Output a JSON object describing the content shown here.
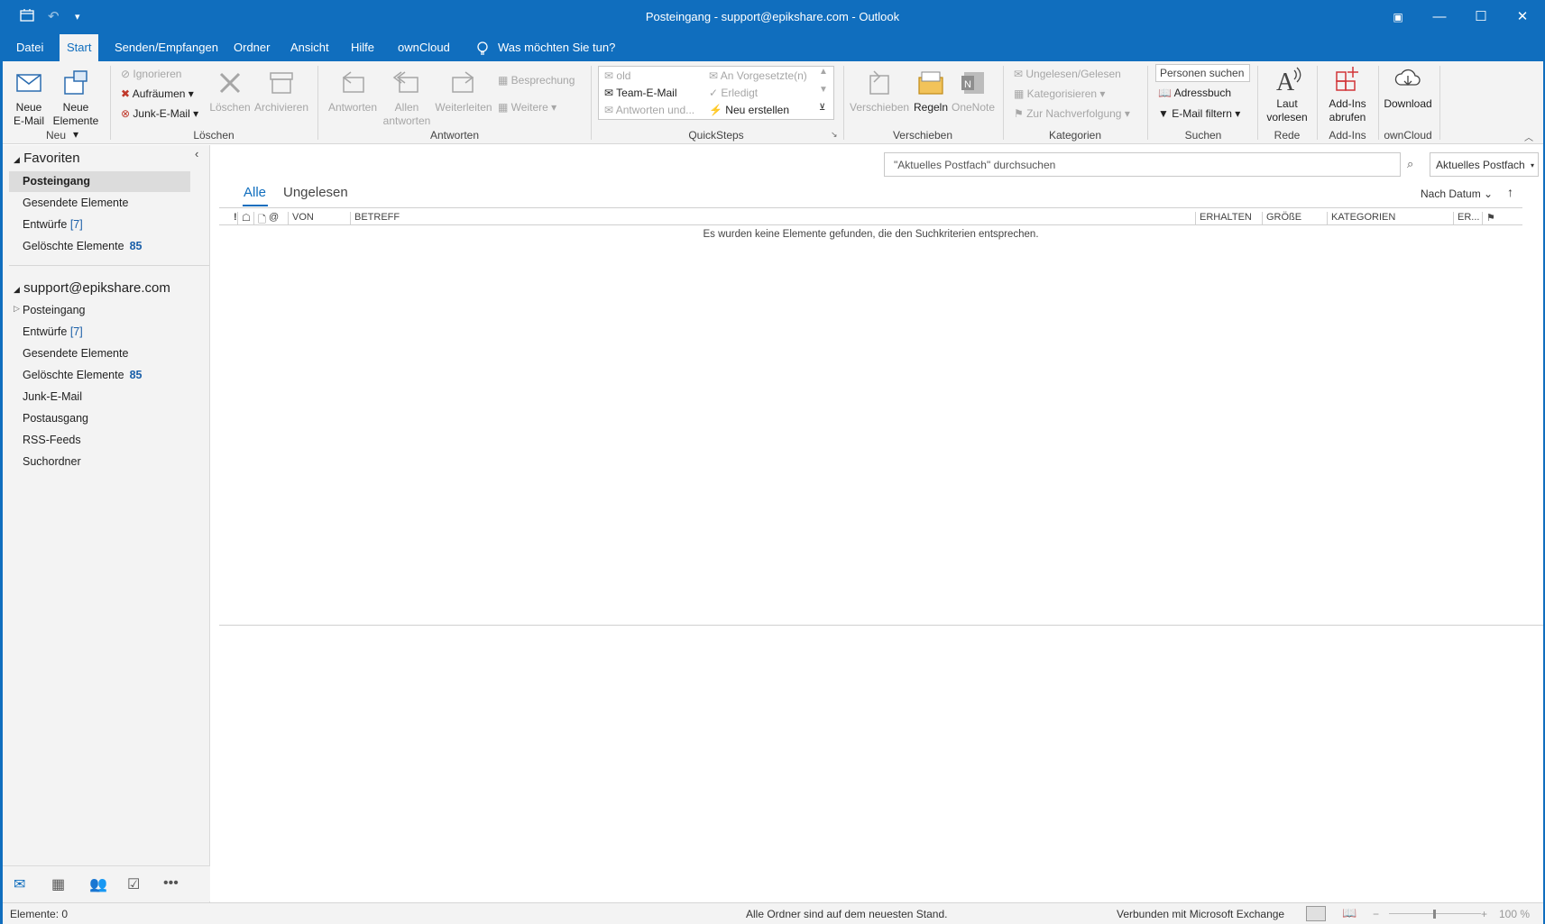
{
  "window": {
    "title": "Posteingang - support@epikshare.com  -  Outlook"
  },
  "menu": [
    "Datei",
    "Start",
    "Senden/Empfangen",
    "Ordner",
    "Ansicht",
    "Hilfe",
    "ownCloud"
  ],
  "tell_me": "Was möchten Sie tun?",
  "ribbon": {
    "neu": {
      "new_email": "Neue E-Mail",
      "new_items": "Neue Elemente",
      "group": "Neu"
    },
    "loeschen": {
      "ignore": "Ignorieren",
      "cleanup": "Aufräumen",
      "junk": "Junk-E-Mail",
      "delete": "Löschen",
      "archive": "Archivieren",
      "group": "Löschen"
    },
    "antworten": {
      "reply": "Antworten",
      "reply_all": "Allen antworten",
      "forward": "Weiterleiten",
      "meeting": "Besprechung",
      "more": "Weitere",
      "group": "Antworten"
    },
    "quicksteps": {
      "items": [
        "old",
        "Team-E-Mail",
        "Antworten und...",
        "An Vorgesetzte(n)",
        "Erledigt",
        "Neu erstellen"
      ],
      "group": "QuickSteps"
    },
    "verschieben": {
      "move": "Verschieben",
      "rules": "Regeln",
      "onenote": "OneNote",
      "group": "Verschieben"
    },
    "kategorien": {
      "unread": "Ungelesen/Gelesen",
      "categorize": "Kategorisieren",
      "followup": "Zur Nachverfolgung",
      "group": "Kategorien"
    },
    "suchen": {
      "people_placeholder": "Personen suchen",
      "addressbook": "Adressbuch",
      "filter": "E-Mail filtern",
      "group": "Suchen"
    },
    "rede": {
      "read_aloud": "Laut vorlesen",
      "group": "Rede"
    },
    "addins": {
      "get": "Add-Ins abrufen",
      "group": "Add-Ins"
    },
    "owncloud": {
      "download": "Download",
      "group": "ownCloud"
    }
  },
  "sidebar": {
    "favorites_header": "Favoriten",
    "favorites": [
      {
        "label": "Posteingang",
        "count": ""
      },
      {
        "label": "Gesendete Elemente",
        "count": ""
      },
      {
        "label": "Entwürfe",
        "count": "[7]"
      },
      {
        "label": "Gelöschte Elemente",
        "count": "85"
      }
    ],
    "account": "support@epikshare.com",
    "folders": [
      {
        "label": "Posteingang",
        "count": ""
      },
      {
        "label": "Entwürfe",
        "count": "[7]"
      },
      {
        "label": "Gesendete Elemente",
        "count": ""
      },
      {
        "label": "Gelöschte Elemente",
        "count": "85"
      },
      {
        "label": "Junk-E-Mail",
        "count": ""
      },
      {
        "label": "Postausgang",
        "count": ""
      },
      {
        "label": "RSS-Feeds",
        "count": ""
      },
      {
        "label": "Suchordner",
        "count": ""
      }
    ]
  },
  "search": {
    "placeholder": "\"Aktuelles Postfach\" durchsuchen",
    "scope": "Aktuelles Postfach"
  },
  "tabs": {
    "all": "Alle",
    "unread": "Ungelesen",
    "sort": "Nach Datum"
  },
  "columns": {
    "from": "VON",
    "subject": "BETREFF",
    "received": "ERHALTEN",
    "size": "GRÖßE",
    "categories": "KATEGORIEN",
    "er": "ER..."
  },
  "empty_message": "Es wurden keine Elemente gefunden, die den Suchkriterien entsprechen.",
  "status": {
    "items": "Elemente: 0",
    "sync": "Alle Ordner sind auf dem neuesten Stand.",
    "connection": "Verbunden mit Microsoft Exchange",
    "zoom": "100 %"
  },
  "colors": {
    "accent": "#106ebe",
    "link": "#1a5fa8"
  }
}
